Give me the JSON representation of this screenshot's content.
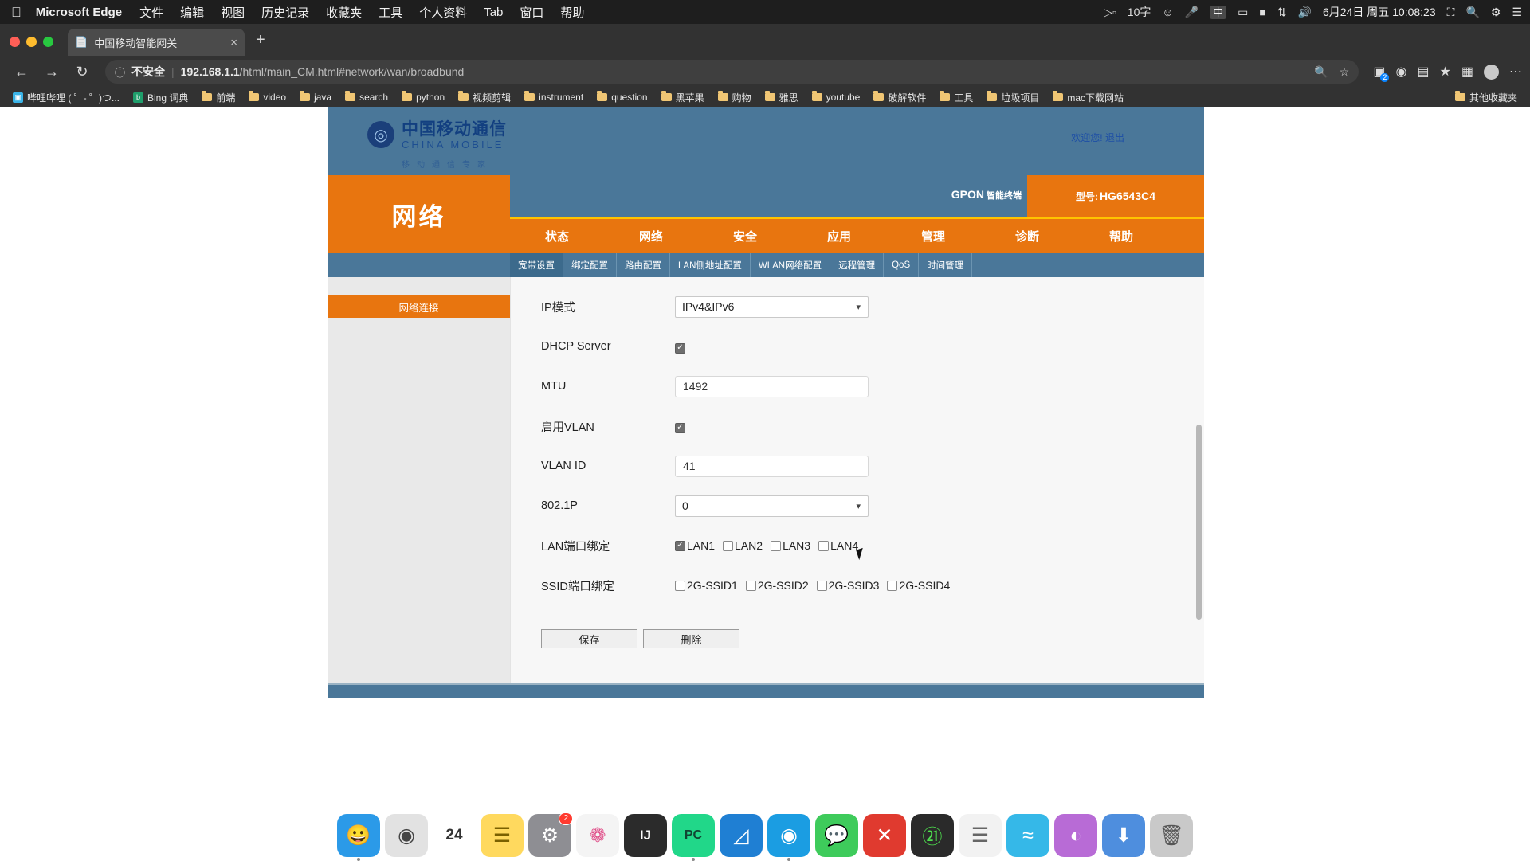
{
  "macbar": {
    "apple": "apple-logo",
    "app": "Microsoft Edge",
    "menus": [
      "文件",
      "编辑",
      "视图",
      "历史记录",
      "收藏夹",
      "工具",
      "个人资料",
      "Tab",
      "窗口",
      "帮助"
    ],
    "status": {
      "screen_record_icon": "screen-record-icon",
      "word_count": "10字",
      "emoji_icon": "emoji-icon",
      "mic_icon": "microphone-icon",
      "ime": "中",
      "display_icon": "display-icon",
      "battery_icon": "battery-icon",
      "bluetooth_icon": "bluetooth-icon",
      "volume_icon": "volume-icon",
      "datetime": "6月24日 周五 10:08:23",
      "shortcut_icon": "shortcuts-icon",
      "search_icon": "search-icon",
      "control_center_icon": "control-center-icon",
      "menu_icon": "menu-icon"
    }
  },
  "browser": {
    "tab": {
      "title": "中国移动智能网关",
      "favicon": "page-icon",
      "close": "×"
    },
    "new_tab": "+",
    "nav": {
      "back": "←",
      "forward": "→",
      "reload": "↻"
    },
    "omnibox": {
      "info_icon": "info-icon",
      "security_label": "不安全",
      "url_host": "192.168.1.1",
      "url_path": "/html/main_CM.html#network/wan/broadbund",
      "zoom_icon": "search-zoom-icon",
      "favorite_icon": "star-icon"
    },
    "toolbar_right": {
      "collections_icon": "collections-icon",
      "collections_badge": "2",
      "browser_essentials_icon": "browser-essentials-icon",
      "split_screen_icon": "split-screen-icon",
      "favorites_icon": "favorites-star-icon",
      "sidebar_icon": "sidebar-icon",
      "profile_icon": "profile-avatar",
      "more_icon": "more-options-icon"
    },
    "bookmarks": [
      {
        "label": "哔哩哔哩 ( ゜- ゜)つ...",
        "icon": "bilibili-favicon",
        "color": "#3ab4e8",
        "glyph": "▣"
      },
      {
        "label": "Bing 词典",
        "icon": "bing-favicon",
        "color": "#1f9e6b",
        "glyph": "b"
      },
      {
        "label": "前端",
        "icon": "folder-icon"
      },
      {
        "label": "video",
        "icon": "folder-icon"
      },
      {
        "label": "java",
        "icon": "folder-icon"
      },
      {
        "label": "search",
        "icon": "folder-icon"
      },
      {
        "label": "python",
        "icon": "folder-icon"
      },
      {
        "label": "视频剪辑",
        "icon": "folder-icon"
      },
      {
        "label": "instrument",
        "icon": "folder-icon"
      },
      {
        "label": "question",
        "icon": "folder-icon"
      },
      {
        "label": "黑苹果",
        "icon": "folder-icon"
      },
      {
        "label": "购物",
        "icon": "folder-icon"
      },
      {
        "label": "雅思",
        "icon": "folder-icon"
      },
      {
        "label": "youtube",
        "icon": "folder-icon"
      },
      {
        "label": "破解软件",
        "icon": "folder-icon"
      },
      {
        "label": "工具",
        "icon": "folder-icon"
      },
      {
        "label": "垃圾项目",
        "icon": "folder-icon"
      },
      {
        "label": "mac下载网站",
        "icon": "folder-icon"
      }
    ],
    "bookmarks_other": {
      "label": "其他收藏夹",
      "icon": "folder-icon"
    }
  },
  "router": {
    "brand": {
      "logo_cn": "中国移动通信",
      "logo_en": "CHINA MOBILE",
      "logo_sub": "移动通信专家",
      "logo_mark": "china-mobile-logo"
    },
    "welcome": {
      "greeting": "欢迎您!",
      "logout": "退出"
    },
    "device": {
      "gpon": "GPON",
      "gpon_sub": "智能终端",
      "model_label": "型号:",
      "model_value": "HG6543C4"
    },
    "section_title": "网络",
    "nav": [
      "状态",
      "网络",
      "安全",
      "应用",
      "管理",
      "诊断",
      "帮助"
    ],
    "subnav": [
      "宽带设置",
      "绑定配置",
      "路由配置",
      "LAN侧地址配置",
      "WLAN网络配置",
      "远程管理",
      "QoS",
      "时间管理"
    ],
    "subnav_active_index": 0,
    "sidebar": [
      {
        "label": "网络连接"
      }
    ],
    "form": {
      "ip_mode": {
        "label": "IP模式",
        "value": "IPv4&IPv6",
        "caret": "⌄"
      },
      "dhcp_server": {
        "label": "DHCP Server",
        "checked": true
      },
      "mtu": {
        "label": "MTU",
        "value": "1492"
      },
      "enable_vlan": {
        "label": "启用VLAN",
        "checked": true
      },
      "vlan_id": {
        "label": "VLAN ID",
        "value": "41"
      },
      "dot1p": {
        "label": "802.1P",
        "value": "0",
        "caret": "⌄"
      },
      "lan_binding": {
        "label": "LAN端口绑定",
        "options": [
          {
            "label": "LAN1",
            "checked": true
          },
          {
            "label": "LAN2",
            "checked": false
          },
          {
            "label": "LAN3",
            "checked": false
          },
          {
            "label": "LAN4",
            "checked": false
          }
        ]
      },
      "ssid_binding": {
        "label": "SSID端口绑定",
        "options": [
          {
            "label": "2G-SSID1",
            "checked": false
          },
          {
            "label": "2G-SSID2",
            "checked": false
          },
          {
            "label": "2G-SSID3",
            "checked": false
          },
          {
            "label": "2G-SSID4",
            "checked": false
          }
        ]
      }
    },
    "buttons": {
      "save": "保存",
      "delete": "删除"
    },
    "colors": {
      "accent_orange": "#e8750f",
      "header_blue": "#4a7799",
      "divider_yellow": "#ffc400"
    }
  },
  "dock": [
    {
      "name": "finder-icon",
      "glyph": "🙂",
      "color": "#2b9ae8",
      "running": true
    },
    {
      "name": "launchpad-icon",
      "glyph": "🚀",
      "color": "#d8d8d8",
      "running": false
    },
    {
      "name": "calendar-icon",
      "glyph": "24",
      "color": "#ffffff",
      "running": false
    },
    {
      "name": "notes-icon",
      "glyph": "▤",
      "color": "#ffd95e",
      "running": false
    },
    {
      "name": "system-settings-icon",
      "glyph": "⚙",
      "color": "#8e8e93",
      "running": false,
      "badge": "2"
    },
    {
      "name": "photos-icon",
      "glyph": "❁",
      "color": "#f4f4f4",
      "running": false
    },
    {
      "name": "intellij-idea-icon",
      "glyph": "IJ",
      "color": "#2b2b2b",
      "running": false
    },
    {
      "name": "pycharm-icon",
      "glyph": "PC",
      "color": "#21d789",
      "running": true
    },
    {
      "name": "vscode-icon",
      "glyph": "◧",
      "color": "#1f7fd3",
      "running": false
    },
    {
      "name": "microsoft-edge-icon",
      "glyph": "◉",
      "color": "#1b9de2",
      "running": true
    },
    {
      "name": "wechat-icon",
      "glyph": "💬",
      "color": "#3ecb5b",
      "running": false
    },
    {
      "name": "xmind-icon",
      "glyph": "✕",
      "color": "#e03a2f",
      "running": false
    },
    {
      "name": "activity-monitor-icon",
      "glyph": "〽",
      "color": "#2a2a2a",
      "running": false
    },
    {
      "name": "text-editor-icon",
      "glyph": "▤",
      "color": "#f2f2f2",
      "running": false
    },
    {
      "name": "wifi-utility-icon",
      "glyph": "≋",
      "color": "#35b8e8",
      "running": false
    },
    {
      "name": "color-app-icon",
      "glyph": "◐",
      "color": "#b86bd6",
      "running": false
    },
    {
      "name": "downloads-folder-icon",
      "glyph": "⬇",
      "color": "#4e8ede",
      "running": false
    },
    {
      "name": "trash-icon",
      "glyph": "🗑",
      "color": "#c9c9c9",
      "running": false
    }
  ]
}
